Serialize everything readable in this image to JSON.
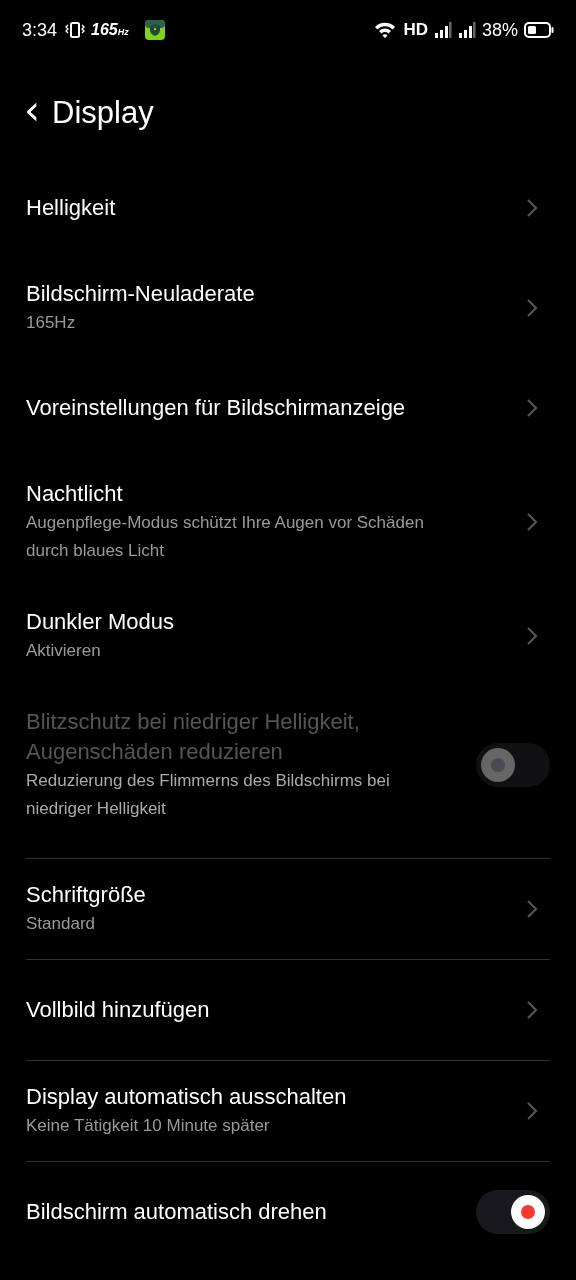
{
  "status_bar": {
    "time": "3:34",
    "refresh": "165",
    "refresh_unit": "Hz",
    "network": "HD",
    "battery": "38%"
  },
  "header": {
    "back": "‹",
    "title": "Display"
  },
  "sections": [
    {
      "dividers": false,
      "items": [
        {
          "kind": "link",
          "title": "Helligkeit",
          "disabled": false
        },
        {
          "kind": "link",
          "title": "Bildschirm-Neuladerate",
          "subtitle": "165Hz",
          "disabled": false
        },
        {
          "kind": "link",
          "title": "Voreinstellungen für Bildschirmanzeige",
          "disabled": false
        },
        {
          "kind": "link",
          "title": "Nachtlicht",
          "subtitle": "Augenpflege-Modus schützt Ihre Augen vor Schäden durch blaues Licht",
          "disabled": false
        },
        {
          "kind": "link",
          "title": "Dunkler Modus",
          "subtitle": "Aktivieren",
          "disabled": false
        },
        {
          "kind": "toggle",
          "title": "Blitzschutz bei niedriger Helligkeit, Augenschäden reduzieren",
          "subtitle": "Reduzierung des Flimmerns des Bildschirms bei niedriger Helligkeit",
          "disabled": true,
          "on": false
        }
      ]
    },
    {
      "dividers": true,
      "items": [
        {
          "kind": "link",
          "title": "Schriftgröße",
          "subtitle": "Standard",
          "disabled": false
        },
        {
          "kind": "link",
          "title": "Vollbild hinzufügen",
          "disabled": false
        },
        {
          "kind": "link",
          "title": "Display automatisch ausschalten",
          "subtitle": "Keine Tätigkeit 10 Minute später",
          "disabled": false
        },
        {
          "kind": "toggle",
          "title": "Bildschirm automatisch drehen",
          "disabled": false,
          "on": true
        }
      ]
    }
  ]
}
